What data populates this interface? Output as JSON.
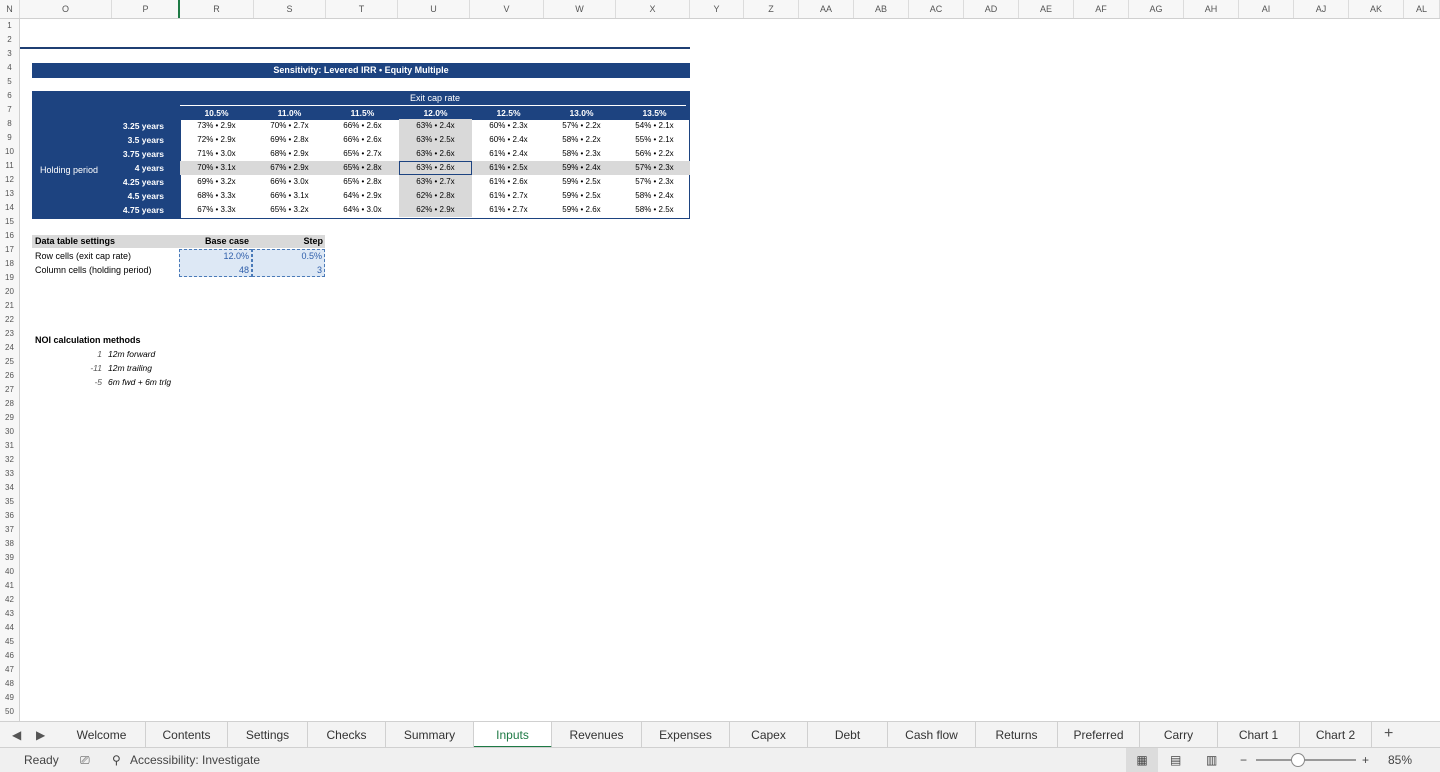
{
  "columns": [
    "N",
    "O",
    "P",
    "R",
    "S",
    "T",
    "U",
    "V",
    "W",
    "X",
    "Y",
    "Z",
    "AA",
    "AB",
    "AC",
    "AD",
    "AE",
    "AF",
    "AG",
    "AH",
    "AI",
    "AJ",
    "AK",
    "AL"
  ],
  "rows": [
    "1",
    "2",
    "3",
    "4",
    "5",
    "6",
    "7",
    "8",
    "9",
    "10",
    "11",
    "12",
    "13",
    "14",
    "15",
    "16",
    "17",
    "18",
    "19",
    "20",
    "21",
    "22",
    "23",
    "24",
    "25",
    "26",
    "27",
    "28",
    "29",
    "30",
    "31",
    "32",
    "33",
    "34",
    "35",
    "36",
    "37",
    "38",
    "39",
    "40",
    "41",
    "42",
    "43",
    "44",
    "45",
    "46",
    "47",
    "48",
    "49",
    "50"
  ],
  "sensitivity": {
    "title": "Sensitivity: Levered IRR • Equity Multiple",
    "col_header": "Exit cap rate",
    "row_header": "Holding period",
    "cap_rates": [
      "10.5%",
      "11.0%",
      "11.5%",
      "12.0%",
      "12.5%",
      "13.0%",
      "13.5%"
    ],
    "periods": [
      "3.25 years",
      "3.5 years",
      "3.75 years",
      "4 years",
      "4.25 years",
      "4.5 years",
      "4.75 years"
    ],
    "values": [
      [
        "73% • 2.9x",
        "70% • 2.7x",
        "66% • 2.6x",
        "63% • 2.4x",
        "60% • 2.3x",
        "57% • 2.2x",
        "54% • 2.1x"
      ],
      [
        "72% • 2.9x",
        "69% • 2.8x",
        "66% • 2.6x",
        "63% • 2.5x",
        "60% • 2.4x",
        "58% • 2.2x",
        "55% • 2.1x"
      ],
      [
        "71% • 3.0x",
        "68% • 2.9x",
        "65% • 2.7x",
        "63% • 2.6x",
        "61% • 2.4x",
        "58% • 2.3x",
        "56% • 2.2x"
      ],
      [
        "70% • 3.1x",
        "67% • 2.9x",
        "65% • 2.8x",
        "63% • 2.6x",
        "61% • 2.5x",
        "59% • 2.4x",
        "57% • 2.3x"
      ],
      [
        "69% • 3.2x",
        "66% • 3.0x",
        "65% • 2.8x",
        "63% • 2.7x",
        "61% • 2.6x",
        "59% • 2.5x",
        "57% • 2.3x"
      ],
      [
        "68% • 3.3x",
        "66% • 3.1x",
        "64% • 2.9x",
        "62% • 2.8x",
        "61% • 2.7x",
        "59% • 2.5x",
        "58% • 2.4x"
      ],
      [
        "67% • 3.3x",
        "65% • 3.2x",
        "64% • 3.0x",
        "62% • 2.9x",
        "61% • 2.7x",
        "59% • 2.6x",
        "58% • 2.5x"
      ]
    ]
  },
  "settings": {
    "header": "Data table settings",
    "base_label": "Base case",
    "step_label": "Step",
    "row1_label": "Row cells (exit cap rate)",
    "row1_base": "12.0%",
    "row1_step": "0.5%",
    "row2_label": "Column cells (holding period)",
    "row2_base": "48",
    "row2_step": "3"
  },
  "noi": {
    "title": "NOI calculation methods",
    "items": [
      {
        "code": "1",
        "label": "12m forward"
      },
      {
        "code": "-11",
        "label": "12m trailing"
      },
      {
        "code": "-5",
        "label": "6m fwd + 6m trlg"
      }
    ]
  },
  "tabs": [
    "Welcome",
    "Contents",
    "Settings",
    "Checks",
    "Summary",
    "Inputs",
    "Revenues",
    "Expenses",
    "Capex",
    "Debt",
    "Cash flow",
    "Returns",
    "Preferred",
    "Carry",
    "Chart 1",
    "Chart 2"
  ],
  "active_tab": "Inputs",
  "status": {
    "ready": "Ready",
    "accessibility": "Accessibility: Investigate",
    "zoom": "85%"
  }
}
